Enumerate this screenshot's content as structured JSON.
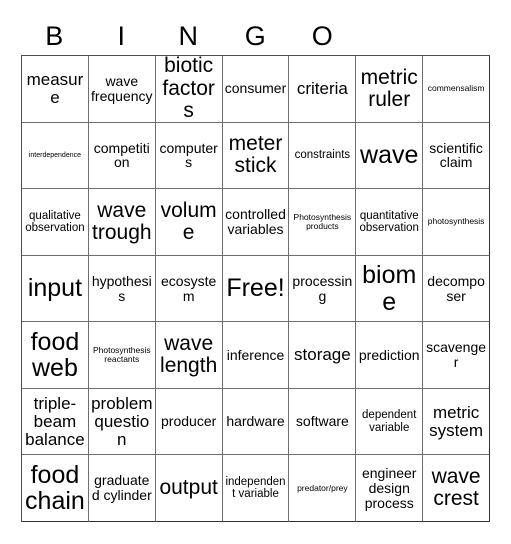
{
  "card": {
    "title": "BINGO",
    "header_letters": [
      "B",
      "I",
      "N",
      "G",
      "O",
      "",
      ""
    ],
    "columns": 7,
    "rows": 7,
    "free_space": "Free!",
    "border_color": "#6e6e6e",
    "text_color": "#000000",
    "background_color": "#ffffff",
    "grid": [
      [
        {
          "text": "measure",
          "size": "lg"
        },
        {
          "text": "wave frequency",
          "size": "md"
        },
        {
          "text": "biotic factors",
          "size": "xl"
        },
        {
          "text": "consumer",
          "size": "md"
        },
        {
          "text": "criteria",
          "size": "lg"
        },
        {
          "text": "metric ruler",
          "size": "xl"
        },
        {
          "text": "commensalism",
          "size": "xs"
        }
      ],
      [
        {
          "text": "interdependence",
          "size": "xxs"
        },
        {
          "text": "competition",
          "size": "md"
        },
        {
          "text": "computers",
          "size": "md"
        },
        {
          "text": "meter stick",
          "size": "xl"
        },
        {
          "text": "constraints",
          "size": "sm"
        },
        {
          "text": "wave",
          "size": "xxl"
        },
        {
          "text": "scientific claim",
          "size": "md"
        }
      ],
      [
        {
          "text": "qualitative observation",
          "size": "sm"
        },
        {
          "text": "wave trough",
          "size": "xl"
        },
        {
          "text": "volume",
          "size": "xl"
        },
        {
          "text": "controlled variables",
          "size": "md"
        },
        {
          "text": "Photosynthesis products",
          "size": "xs"
        },
        {
          "text": "quantitative observation",
          "size": "sm"
        },
        {
          "text": "photosynthesis",
          "size": "xs"
        }
      ],
      [
        {
          "text": "input",
          "size": "xxl"
        },
        {
          "text": "hypothesis",
          "size": "md"
        },
        {
          "text": "ecosystem",
          "size": "md"
        },
        {
          "text": "Free!",
          "size": "xxl"
        },
        {
          "text": "processing",
          "size": "md"
        },
        {
          "text": "biome",
          "size": "xxl"
        },
        {
          "text": "decomposer",
          "size": "md"
        }
      ],
      [
        {
          "text": "food web",
          "size": "xxl"
        },
        {
          "text": "Photosynthesis reactants",
          "size": "xs"
        },
        {
          "text": "wave length",
          "size": "xl"
        },
        {
          "text": "inference",
          "size": "md"
        },
        {
          "text": "storage",
          "size": "lg"
        },
        {
          "text": "prediction",
          "size": "md"
        },
        {
          "text": "scavenger",
          "size": "md"
        }
      ],
      [
        {
          "text": "triple-beam balance",
          "size": "lg"
        },
        {
          "text": "problem question",
          "size": "lg"
        },
        {
          "text": "producer",
          "size": "md"
        },
        {
          "text": "hardware",
          "size": "md"
        },
        {
          "text": "software",
          "size": "md"
        },
        {
          "text": "dependent variable",
          "size": "sm"
        },
        {
          "text": "metric system",
          "size": "lg"
        }
      ],
      [
        {
          "text": "food chain",
          "size": "xxl"
        },
        {
          "text": "graduated cylinder",
          "size": "md"
        },
        {
          "text": "output",
          "size": "xl"
        },
        {
          "text": "independent variable",
          "size": "sm"
        },
        {
          "text": "predator/prey",
          "size": "xs"
        },
        {
          "text": "engineer design process",
          "size": "md"
        },
        {
          "text": "wave crest",
          "size": "xl"
        }
      ]
    ]
  }
}
